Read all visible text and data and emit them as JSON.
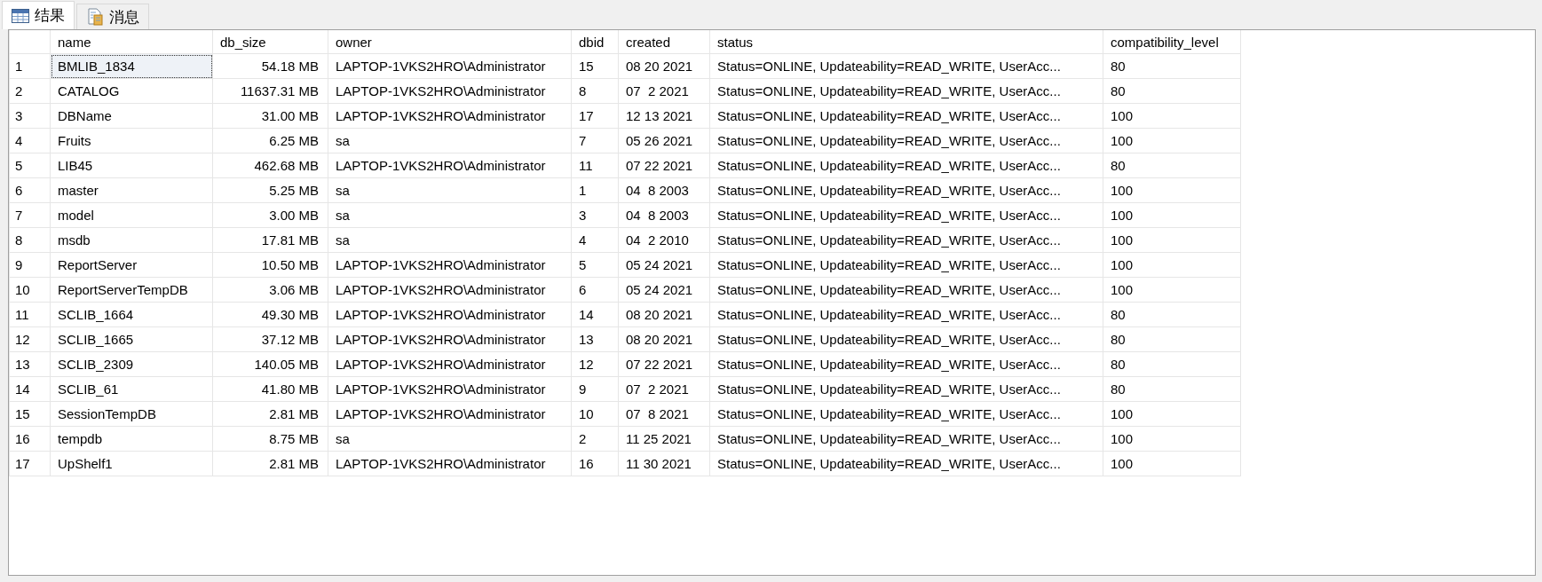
{
  "tabs": [
    {
      "label": "结果",
      "kind": "grid",
      "selected": true
    },
    {
      "label": "消息",
      "kind": "message",
      "selected": false
    }
  ],
  "table": {
    "columns": [
      "name",
      "db_size",
      "owner",
      "dbid",
      "created",
      "status",
      "compatibility_level"
    ],
    "rows": [
      {
        "num": "1",
        "cells": [
          "BMLIB_1834",
          "54.18 MB",
          "LAPTOP-1VKS2HRO\\Administrator",
          "15",
          "08 20 2021",
          "Status=ONLINE, Updateability=READ_WRITE, UserAcc...",
          "80"
        ],
        "focused": true
      },
      {
        "num": "2",
        "cells": [
          "CATALOG",
          "11637.31 MB",
          "LAPTOP-1VKS2HRO\\Administrator",
          "8",
          "07  2 2021",
          "Status=ONLINE, Updateability=READ_WRITE, UserAcc...",
          "80"
        ],
        "focused": false
      },
      {
        "num": "3",
        "cells": [
          "DBName",
          "31.00 MB",
          "LAPTOP-1VKS2HRO\\Administrator",
          "17",
          "12 13 2021",
          "Status=ONLINE, Updateability=READ_WRITE, UserAcc...",
          "100"
        ],
        "focused": false
      },
      {
        "num": "4",
        "cells": [
          "Fruits",
          "6.25 MB",
          "sa",
          "7",
          "05 26 2021",
          "Status=ONLINE, Updateability=READ_WRITE, UserAcc...",
          "100"
        ],
        "focused": false
      },
      {
        "num": "5",
        "cells": [
          "LIB45",
          "462.68 MB",
          "LAPTOP-1VKS2HRO\\Administrator",
          "11",
          "07 22 2021",
          "Status=ONLINE, Updateability=READ_WRITE, UserAcc...",
          "80"
        ],
        "focused": false
      },
      {
        "num": "6",
        "cells": [
          "master",
          "5.25 MB",
          "sa",
          "1",
          "04  8 2003",
          "Status=ONLINE, Updateability=READ_WRITE, UserAcc...",
          "100"
        ],
        "focused": false
      },
      {
        "num": "7",
        "cells": [
          "model",
          "3.00 MB",
          "sa",
          "3",
          "04  8 2003",
          "Status=ONLINE, Updateability=READ_WRITE, UserAcc...",
          "100"
        ],
        "focused": false
      },
      {
        "num": "8",
        "cells": [
          "msdb",
          "17.81 MB",
          "sa",
          "4",
          "04  2 2010",
          "Status=ONLINE, Updateability=READ_WRITE, UserAcc...",
          "100"
        ],
        "focused": false
      },
      {
        "num": "9",
        "cells": [
          "ReportServer",
          "10.50 MB",
          "LAPTOP-1VKS2HRO\\Administrator",
          "5",
          "05 24 2021",
          "Status=ONLINE, Updateability=READ_WRITE, UserAcc...",
          "100"
        ],
        "focused": false
      },
      {
        "num": "10",
        "cells": [
          "ReportServerTempDB",
          "3.06 MB",
          "LAPTOP-1VKS2HRO\\Administrator",
          "6",
          "05 24 2021",
          "Status=ONLINE, Updateability=READ_WRITE, UserAcc...",
          "100"
        ],
        "focused": false
      },
      {
        "num": "11",
        "cells": [
          "SCLIB_1664",
          "49.30 MB",
          "LAPTOP-1VKS2HRO\\Administrator",
          "14",
          "08 20 2021",
          "Status=ONLINE, Updateability=READ_WRITE, UserAcc...",
          "80"
        ],
        "focused": false
      },
      {
        "num": "12",
        "cells": [
          "SCLIB_1665",
          "37.12 MB",
          "LAPTOP-1VKS2HRO\\Administrator",
          "13",
          "08 20 2021",
          "Status=ONLINE, Updateability=READ_WRITE, UserAcc...",
          "80"
        ],
        "focused": false
      },
      {
        "num": "13",
        "cells": [
          "SCLIB_2309",
          "140.05 MB",
          "LAPTOP-1VKS2HRO\\Administrator",
          "12",
          "07 22 2021",
          "Status=ONLINE, Updateability=READ_WRITE, UserAcc...",
          "80"
        ],
        "focused": false
      },
      {
        "num": "14",
        "cells": [
          "SCLIB_61",
          "41.80 MB",
          "LAPTOP-1VKS2HRO\\Administrator",
          "9",
          "07  2 2021",
          "Status=ONLINE, Updateability=READ_WRITE, UserAcc...",
          "80"
        ],
        "focused": false
      },
      {
        "num": "15",
        "cells": [
          "SessionTempDB",
          "2.81 MB",
          "LAPTOP-1VKS2HRO\\Administrator",
          "10",
          "07  8 2021",
          "Status=ONLINE, Updateability=READ_WRITE, UserAcc...",
          "100"
        ],
        "focused": false
      },
      {
        "num": "16",
        "cells": [
          "tempdb",
          "8.75 MB",
          "sa",
          "2",
          "11 25 2021",
          "Status=ONLINE, Updateability=READ_WRITE, UserAcc...",
          "100"
        ],
        "focused": false
      },
      {
        "num": "17",
        "cells": [
          "UpShelf1",
          "2.81 MB",
          "LAPTOP-1VKS2HRO\\Administrator",
          "16",
          "11 30 2021",
          "Status=ONLINE, Updateability=READ_WRITE, UserAcc...",
          "100"
        ],
        "focused": false
      }
    ]
  }
}
